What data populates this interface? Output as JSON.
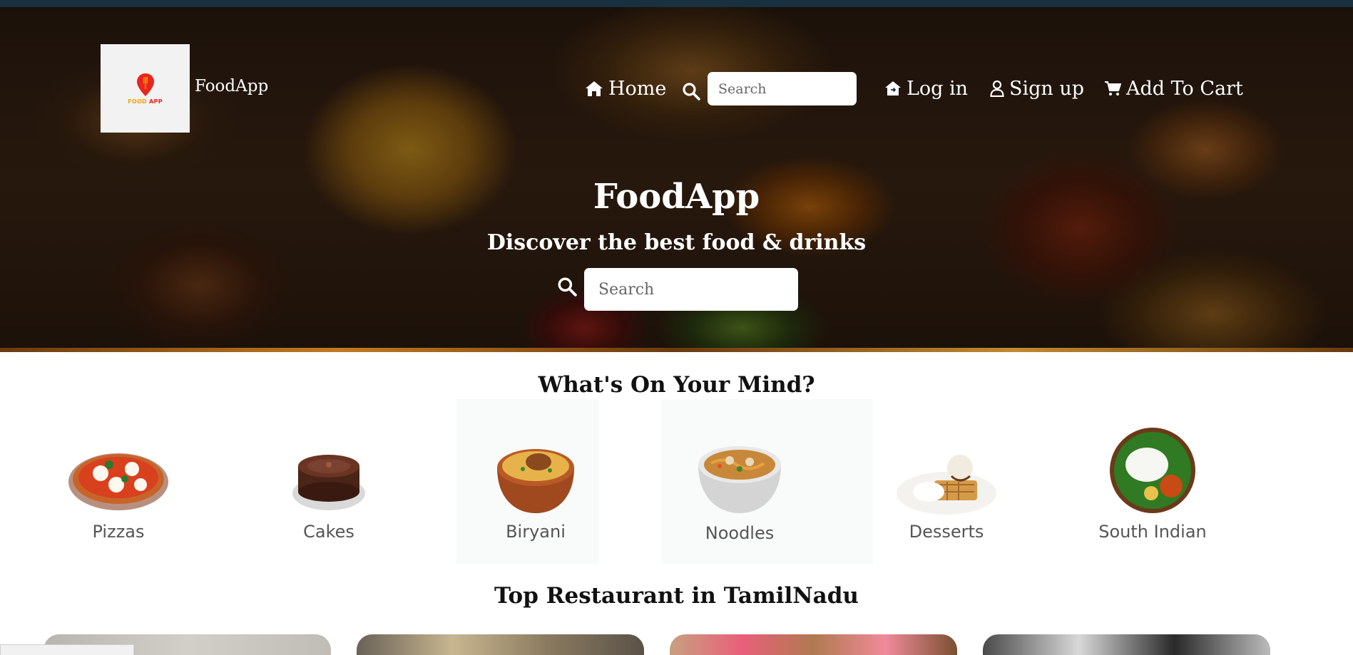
{
  "brand": {
    "logo_word_1": "FOOD",
    "logo_word_2": "APP",
    "name": "FoodApp",
    "logo_colors": {
      "pin": "#e8261c",
      "text_yellow": "#f2a300"
    }
  },
  "nav": {
    "home_label": "Home",
    "search_placeholder": "Search",
    "login_label": "Log in",
    "signup_label": "Sign up",
    "cart_label": "Add To Cart",
    "icons": [
      "home-icon",
      "search-icon",
      "login-house-icon",
      "user-icon",
      "cart-icon"
    ]
  },
  "hero": {
    "title": "FoodApp",
    "subtitle": "Discover the best food & drinks",
    "search_placeholder": "Search"
  },
  "categories": {
    "title": "What's On Your Mind?",
    "items": [
      {
        "label": "Pizzas",
        "icon": "pizza-icon"
      },
      {
        "label": "Cakes",
        "icon": "cake-icon"
      },
      {
        "label": "Biryani",
        "icon": "biryani-icon"
      },
      {
        "label": "Noodles",
        "icon": "noodles-icon"
      },
      {
        "label": "Desserts",
        "icon": "dessert-icon"
      },
      {
        "label": "South Indian",
        "icon": "idli-icon"
      }
    ]
  },
  "restaurants": {
    "title": "Top Restaurant in TamilNadu"
  },
  "colors": {
    "topbar": "#18303f",
    "text_dark": "#111111",
    "category_label": "#555555"
  }
}
